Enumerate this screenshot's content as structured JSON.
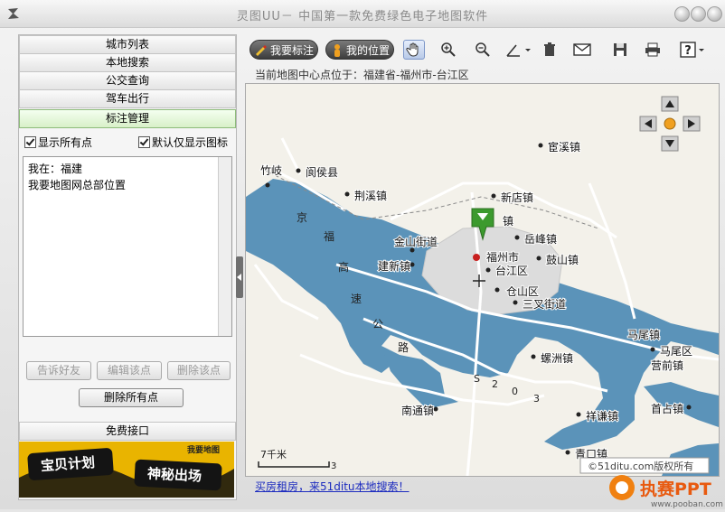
{
  "window": {
    "title": "灵图UU－ 中国第一款免费绿色电子地图软件"
  },
  "sidebar": {
    "menu": [
      "城市列表",
      "本地搜索",
      "公交查询",
      "驾车出行",
      "标注管理"
    ],
    "show_all_points": "显示所有点",
    "default_icon_only": "默认仅显示图标",
    "markers": [
      "我在：福建",
      "我要地图网总部位置"
    ],
    "buttons": {
      "tell_friend": "告诉好友",
      "edit_point": "编辑该点",
      "delete_point": "删除该点",
      "delete_all": "删除所有点"
    },
    "footer_item": "免费接口",
    "banner": {
      "left": "宝贝计划",
      "right": "神秘出场",
      "badge": "我要地图"
    }
  },
  "toolbar": {
    "mark_label": "我要标注",
    "my_location_label": "我的位置"
  },
  "status": {
    "center_text": "当前地图中心点位于：福建省-福州市-台江区"
  },
  "map": {
    "labels": [
      {
        "text": "宦溪镇"
      },
      {
        "text": "阆侯县"
      },
      {
        "text": "荆溪镇"
      },
      {
        "text": "新店镇"
      },
      {
        "text": "镇"
      },
      {
        "text": "岳峰镇"
      },
      {
        "text": "金山街道"
      },
      {
        "text": "福州市"
      },
      {
        "text": "台江区"
      },
      {
        "text": "鼓山镇"
      },
      {
        "text": "建新镇"
      },
      {
        "text": "仓山区"
      },
      {
        "text": "三叉街道"
      },
      {
        "text": "马尾镇"
      },
      {
        "text": "马尾区"
      },
      {
        "text": "螺洲镇"
      },
      {
        "text": "营前镇"
      },
      {
        "text": "南通镇"
      },
      {
        "text": "祥谦镇"
      },
      {
        "text": "首占镇"
      },
      {
        "text": "青口镇"
      },
      {
        "text": "竹岐"
      }
    ],
    "road_chars": [
      "京",
      "福",
      "高",
      "速",
      "公",
      "路"
    ],
    "road_code": [
      "S",
      "2",
      "0",
      "3"
    ],
    "scale": "7千米",
    "scale_end": "3",
    "copyright": "©51ditu.com版权所有"
  },
  "bottom": {
    "link_text": "买房租房，来51ditu本地搜索！"
  },
  "logo": {
    "brand": "执赛PPT",
    "url": "www.pooban.com"
  },
  "colors": {
    "water": "#5b93b9",
    "accent_green": "#3c9a2e",
    "city_red": "#c8201f"
  }
}
